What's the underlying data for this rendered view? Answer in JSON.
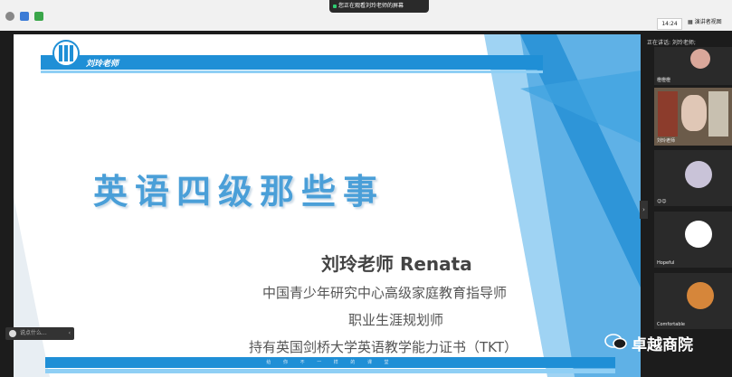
{
  "top_bar": {
    "sharing_label": "您正在观看刘玲老师的屏幕",
    "time": "14:24",
    "view_label": "演讲者视图"
  },
  "slide": {
    "header_name": "刘玲老师",
    "headline": "英语四级那些事",
    "teacher": "刘玲老师  Renata",
    "credentials": [
      "中国青少年研究中心高级家庭教育指导师",
      "职业生涯规划师",
      "持有英国剑桥大学英语教学能力证书（TKT）"
    ],
    "bottom_banner": "给 你 不 一 样 的 课 堂"
  },
  "comment_box": {
    "placeholder": "说点什么..."
  },
  "sidebar": {
    "speaking_label": "正在讲话: 刘玲老师;",
    "participants": [
      {
        "name": "橙橙橙"
      },
      {
        "name": "刘玲老师"
      },
      {
        "name": "☺☺"
      },
      {
        "name": "Hopeful"
      },
      {
        "name": "Comfortable"
      }
    ]
  },
  "watermark": "卓越商院",
  "colors": {
    "accent": "#1f8fd6",
    "headline": "#4a9fd8",
    "dark_bg": "#1c1c1c"
  }
}
